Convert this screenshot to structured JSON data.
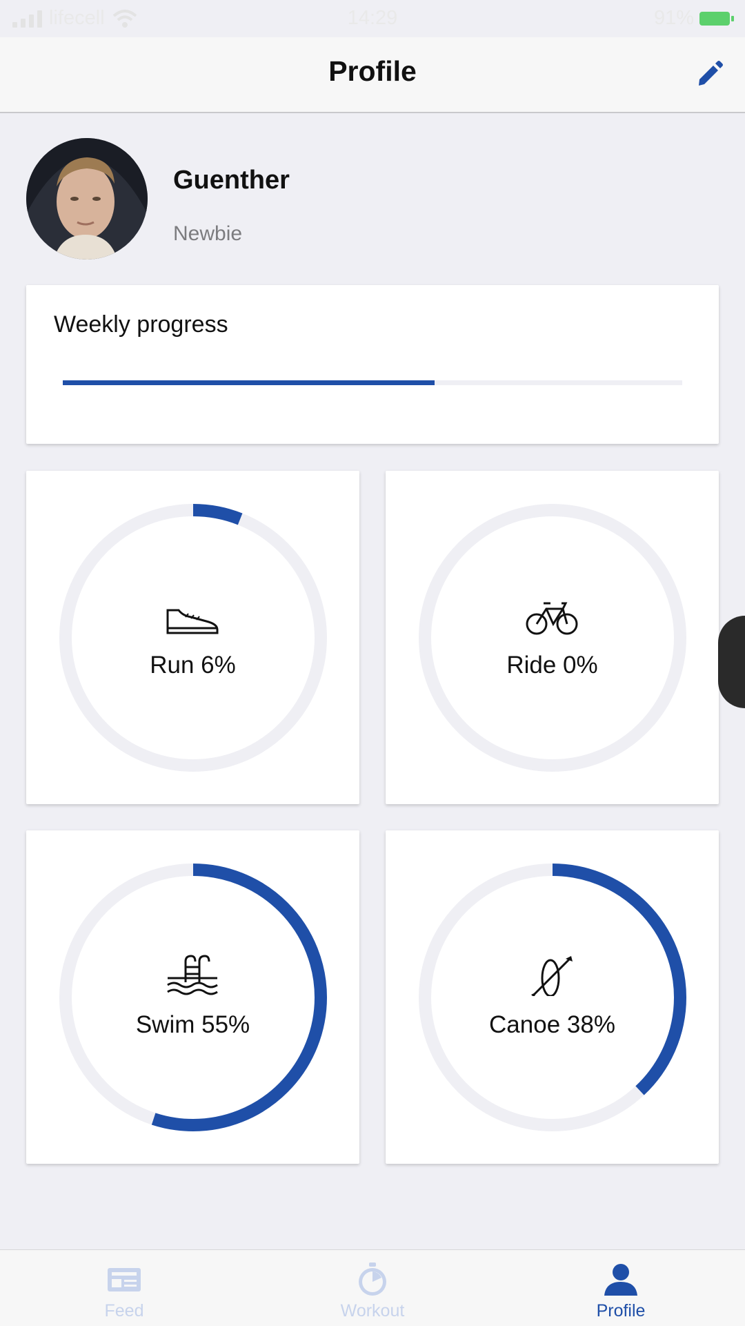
{
  "status": {
    "carrier": "lifecell",
    "time": "14:29",
    "battery": "91%"
  },
  "nav": {
    "title": "Profile",
    "edit_icon": "pencil-icon"
  },
  "profile": {
    "name": "Guenther",
    "level": "Newbie"
  },
  "weekly": {
    "title": "Weekly progress",
    "progress": 0.6
  },
  "activities": [
    {
      "label": "Run 6%",
      "progress": 0.06,
      "icon": "shoe-icon"
    },
    {
      "label": "Ride 0%",
      "progress": 0.0,
      "icon": "bicycle-icon"
    },
    {
      "label": "Swim 55%",
      "progress": 0.55,
      "icon": "pool-icon"
    },
    {
      "label": "Canoe 38%",
      "progress": 0.38,
      "icon": "canoe-icon"
    }
  ],
  "tabs": [
    {
      "label": "Feed",
      "icon": "feed-icon",
      "active": false
    },
    {
      "label": "Workout",
      "icon": "stopwatch-icon",
      "active": false
    },
    {
      "label": "Profile",
      "icon": "person-icon",
      "active": true
    }
  ],
  "colors": {
    "accent": "#1f4fa8",
    "track": "#efeff4",
    "background": "#efeff4"
  }
}
